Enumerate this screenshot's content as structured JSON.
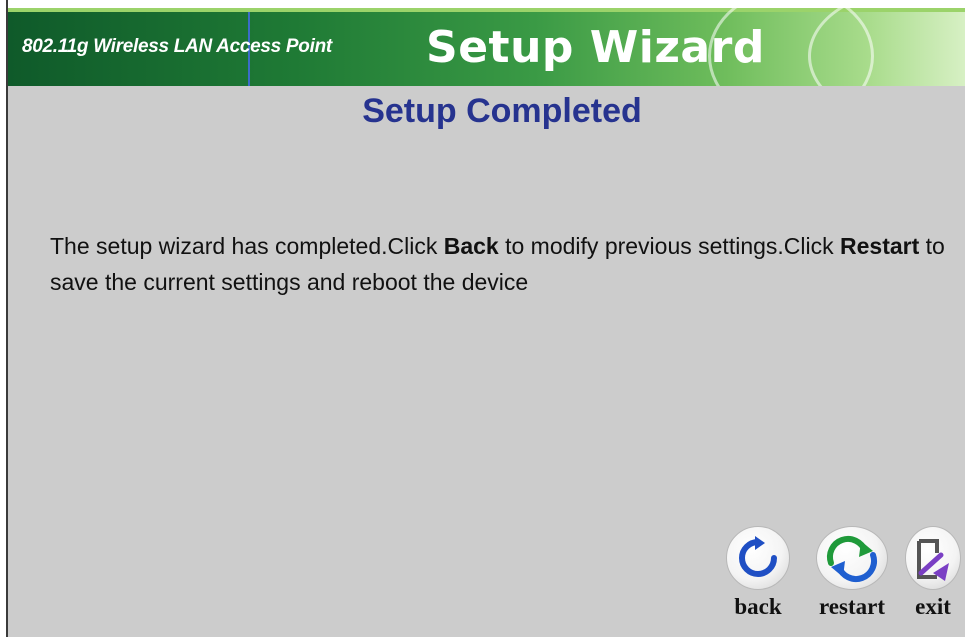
{
  "banner": {
    "product_name": "802.11g Wireless LAN Access Point",
    "wizard_title": "Setup Wizard"
  },
  "page": {
    "title": "Setup Completed",
    "message": {
      "part1": "The setup wizard has completed.Click ",
      "back_word": "Back",
      "part2": " to modify previous settings.Click ",
      "restart_word": "Restart",
      "part3": " to save the current settings and reboot the device"
    }
  },
  "nav_buttons": {
    "back": {
      "label": "back",
      "icon": "back-arrow-icon"
    },
    "restart": {
      "label": "restart",
      "icon": "restart-arrows-icon"
    },
    "exit": {
      "label": "exit",
      "icon": "exit-door-icon"
    }
  },
  "colors": {
    "banner_green": "#1f7a35",
    "title_blue": "#26338f",
    "content_gray": "#cccccc"
  }
}
